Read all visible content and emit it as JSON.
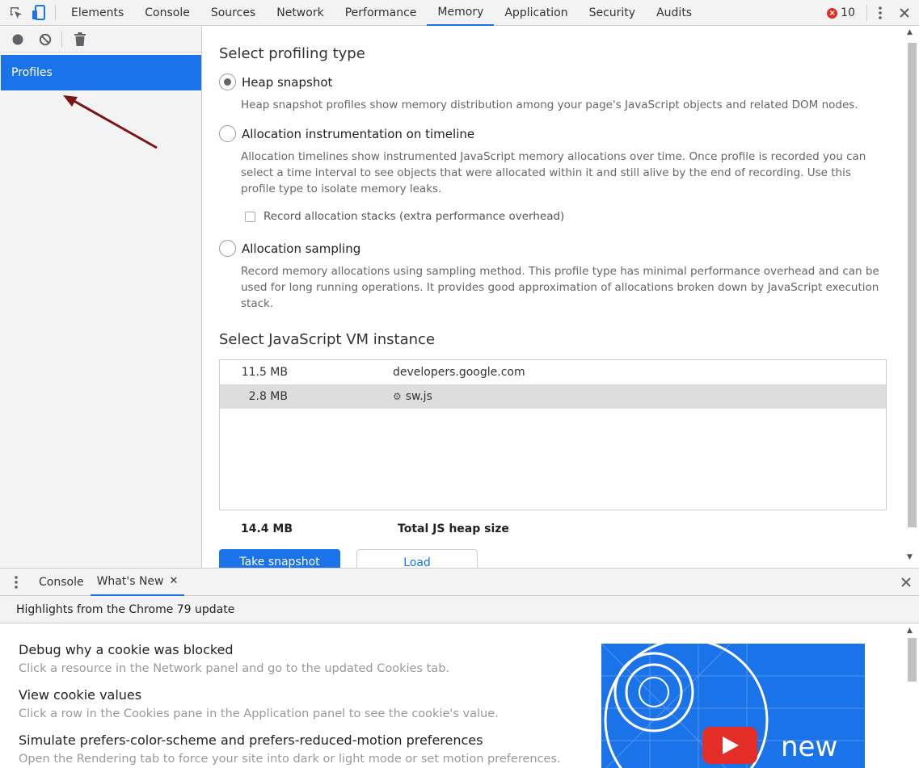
{
  "toolbar": {
    "tabs": [
      {
        "label": "Elements"
      },
      {
        "label": "Console"
      },
      {
        "label": "Sources"
      },
      {
        "label": "Network"
      },
      {
        "label": "Performance"
      },
      {
        "label": "Memory"
      },
      {
        "label": "Application"
      },
      {
        "label": "Security"
      },
      {
        "label": "Audits"
      }
    ],
    "active_tab": "Memory",
    "error_count": "10"
  },
  "sidebar": {
    "items": [
      {
        "label": "Profiles",
        "selected": true
      }
    ]
  },
  "main": {
    "profiling_title": "Select profiling type",
    "options": [
      {
        "label": "Heap snapshot",
        "checked": true,
        "description": "Heap snapshot profiles show memory distribution among your page's JavaScript objects and related DOM nodes."
      },
      {
        "label": "Allocation instrumentation on timeline",
        "checked": false,
        "description": "Allocation timelines show instrumented JavaScript memory allocations over time. Once profile is recorded you can select a time interval to see objects that were allocated within it and still alive by the end of recording. Use this profile type to isolate memory leaks."
      },
      {
        "label": "Allocation sampling",
        "checked": false,
        "description": "Record memory allocations using sampling method. This profile type has minimal performance overhead and can be used for long running operations. It provides good approximation of allocations broken down by JavaScript execution stack."
      }
    ],
    "record_stacks_label": "Record allocation stacks (extra performance overhead)",
    "vm_title": "Select JavaScript VM instance",
    "vm_instances": [
      {
        "size": "11.5 MB",
        "name": "developers.google.com",
        "selected": false
      },
      {
        "size": "2.8 MB",
        "name": "sw.js",
        "selected": true,
        "icon": "gear-icon"
      }
    ],
    "total_size": "14.4 MB",
    "total_label": "Total JS heap size",
    "take_snapshot_label": "Take snapshot",
    "load_label": "Load"
  },
  "drawer": {
    "tabs": [
      {
        "label": "Console"
      },
      {
        "label": "What's New",
        "closable": true
      }
    ],
    "active_tab": "What's New",
    "highlight": "Highlights from the Chrome 79 update",
    "items": [
      {
        "title": "Debug why a cookie was blocked",
        "description": "Click a resource in the Network panel and go to the updated Cookies tab."
      },
      {
        "title": "View cookie values",
        "description": "Click a row in the Cookies pane in the Application panel to see the cookie's value."
      },
      {
        "title": "Simulate prefers-color-scheme and prefers-reduced-motion preferences",
        "description": "Open the Rendering tab to force your site into dark or light mode or set motion preferences."
      }
    ],
    "promo_text": "new"
  },
  "colors": {
    "accent": "#1a73e8",
    "error": "#d93025",
    "toolbar_bg": "#f3f3f3",
    "annotation_arrow": "#7b1414"
  }
}
